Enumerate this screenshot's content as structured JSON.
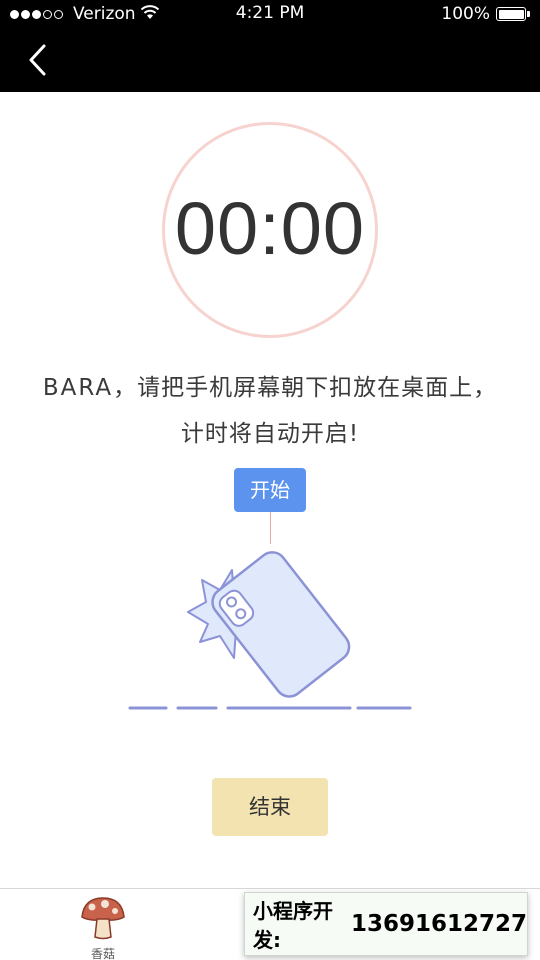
{
  "status_bar": {
    "carrier": "Verizon",
    "time": "4:21 PM",
    "battery": "100%"
  },
  "timer": {
    "value": "00:00"
  },
  "instruction": {
    "name": "BARA",
    "line1_rest": "，请把手机屏幕朝下扣放在桌面上，",
    "line2": "计时将自动开启!"
  },
  "start_button": {
    "label": "开始"
  },
  "end_button": {
    "label": "结束"
  },
  "tab_bar": {
    "items": [
      {
        "label": "香菇",
        "icon": "mushroom-icon"
      }
    ]
  },
  "overlay": {
    "label": "小程序开发:",
    "phone": "13691612727"
  },
  "colors": {
    "start_button": "#5b93ee",
    "end_button": "#f2e3b1",
    "ring": "#f7d3cf",
    "phone_outline": "#8b93d6",
    "phone_fill": "#dfe9fb"
  }
}
